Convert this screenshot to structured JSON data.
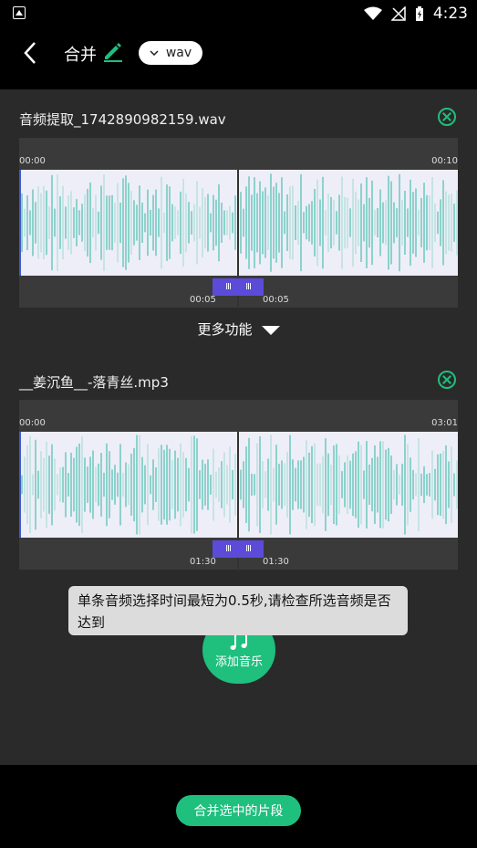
{
  "status": {
    "time": "4:23"
  },
  "header": {
    "title": "合并",
    "format": "wav"
  },
  "files": [
    {
      "name": "音频提取_1742890982159.wav",
      "start_label": "00:00",
      "end_label": "00:10",
      "sel_start": "00:05",
      "sel_end": "00:05"
    },
    {
      "name": "__姜沉鱼__-落青丝.mp3",
      "start_label": "00:00",
      "end_label": "03:01",
      "sel_start": "01:30",
      "sel_end": "01:30"
    }
  ],
  "more_label": "更多功能",
  "add_music_label": "添加音乐",
  "toast": "单条音频选择时间最短为0.5秒,请检查所选音频是否达到",
  "merge_label": "合并选中的片段",
  "colors": {
    "accent": "#1fbf7e",
    "handle": "#5b4bd8",
    "wave": "#2bb5a0"
  }
}
